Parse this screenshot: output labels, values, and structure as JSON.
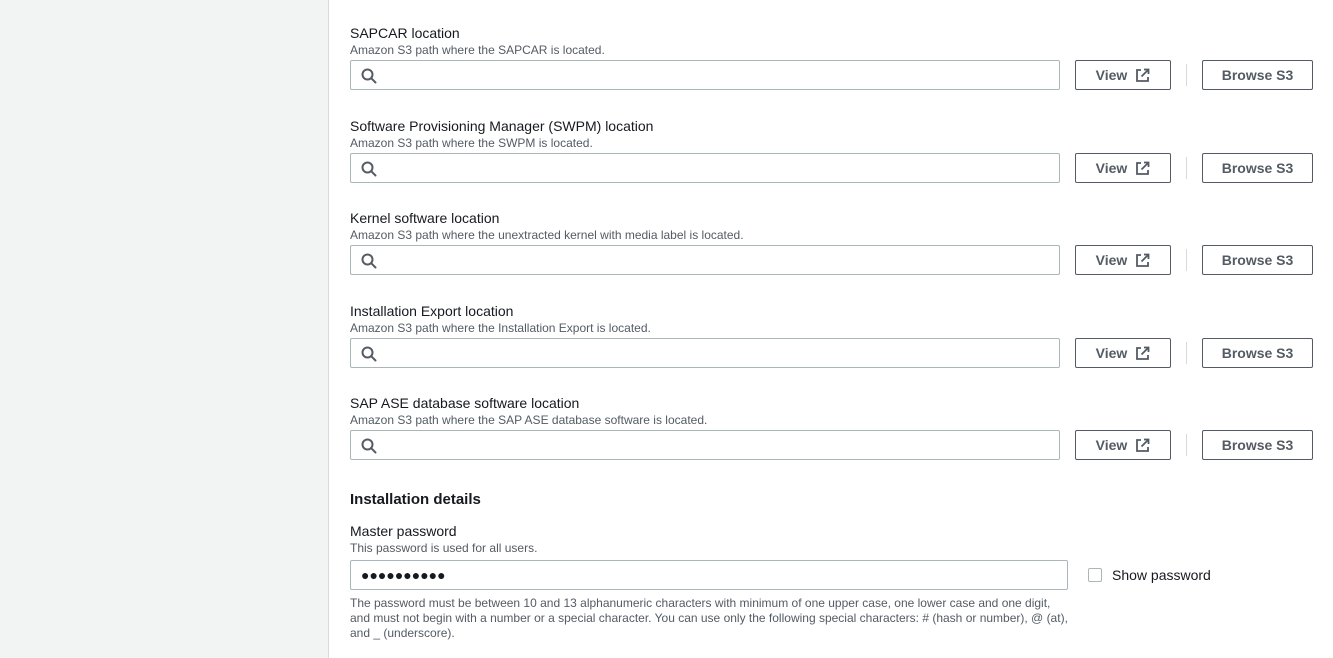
{
  "locations": [
    {
      "label": "SAPCAR location",
      "description": "Amazon S3 path where the SAPCAR is located.",
      "value": "",
      "view_label": "View",
      "browse_label": "Browse S3"
    },
    {
      "label": "Software Provisioning Manager (SWPM) location",
      "description": "Amazon S3 path where the SWPM is located.",
      "value": "",
      "view_label": "View",
      "browse_label": "Browse S3"
    },
    {
      "label": "Kernel software location",
      "description": "Amazon S3 path where the unextracted kernel with media label is located.",
      "value": "",
      "view_label": "View",
      "browse_label": "Browse S3"
    },
    {
      "label": "Installation Export location",
      "description": "Amazon S3 path where the Installation Export is located.",
      "value": "",
      "view_label": "View",
      "browse_label": "Browse S3"
    },
    {
      "label": "SAP ASE database software location",
      "description": "Amazon S3 path where the SAP ASE database software is located.",
      "value": "",
      "view_label": "View",
      "browse_label": "Browse S3"
    }
  ],
  "installation": {
    "title": "Installation details",
    "password_label": "Master password",
    "password_description": "This password is used for all users.",
    "password_value": "●●●●●●●●●●",
    "show_password_label": "Show password",
    "constraint_text": "The password must be between 10 and 13 alphanumeric characters with minimum of one upper case, one lower case and one digit, and must not begin with a number or a special character. You can use only the following special characters: # (hash or number), @ (at), and _ (underscore)."
  },
  "icons": {
    "search": "search-icon",
    "external": "external-link-icon"
  }
}
